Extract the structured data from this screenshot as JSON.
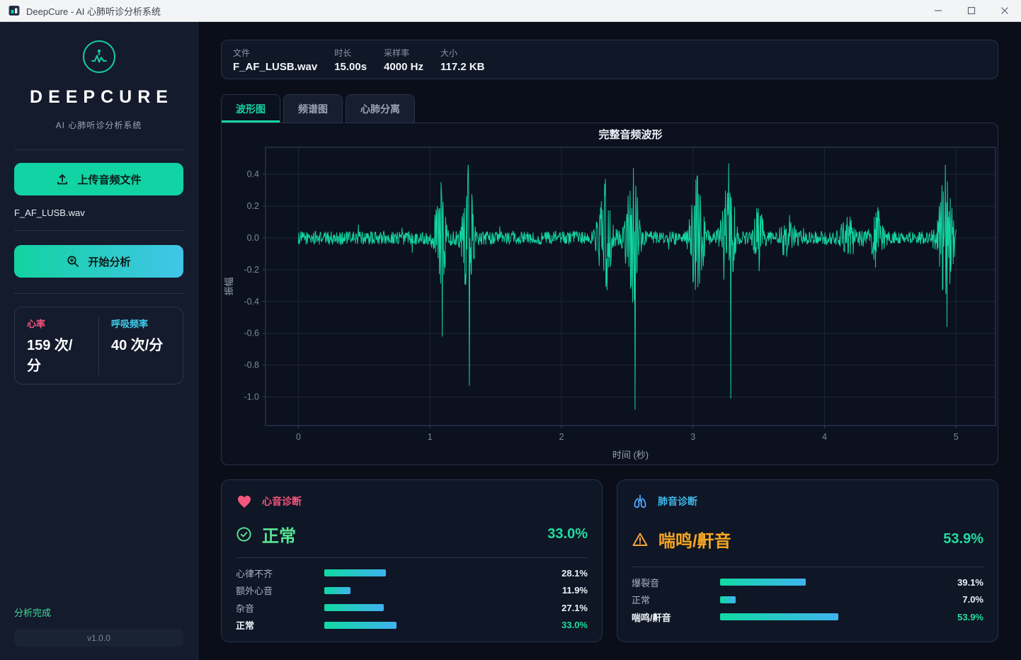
{
  "window": {
    "title": "DeepCure - AI 心肺听诊分析系统"
  },
  "sidebar": {
    "brand": "DEEPCURE",
    "subtitle": "AI 心肺听诊分析系统",
    "upload_button": "上传音频文件",
    "file_name": "F_AF_LUSB.wav",
    "analyze_button": "开始分析",
    "stats": {
      "heart_rate_label": "心率",
      "heart_rate_value": "159 次/分",
      "resp_rate_label": "呼吸频率",
      "resp_rate_value": "40 次/分"
    },
    "status": "分析完成",
    "version": "v1.0.0"
  },
  "file_info": {
    "items": [
      {
        "label": "文件",
        "value": "F_AF_LUSB.wav"
      },
      {
        "label": "时长",
        "value": "15.00s"
      },
      {
        "label": "采样率",
        "value": "4000 Hz"
      },
      {
        "label": "大小",
        "value": "117.2 KB"
      }
    ]
  },
  "tabs": [
    {
      "label": "波形图",
      "active": true
    },
    {
      "label": "频谱图",
      "active": false
    },
    {
      "label": "心肺分离",
      "active": false
    }
  ],
  "chart_data": {
    "type": "line",
    "title": "完整音频波形",
    "xlabel": "时间 (秒)",
    "ylabel": "振幅",
    "xlim": [
      -0.25,
      5.3
    ],
    "ylim": [
      -1.18,
      0.57
    ],
    "x_ticks": [
      0,
      1,
      2,
      3,
      4,
      5
    ],
    "x_tick_labels": [
      "0",
      "1",
      "2",
      "3",
      "4",
      "5"
    ],
    "y_ticks": [
      0.4,
      0.2,
      0.0,
      -0.2,
      -0.4,
      -0.6,
      -0.8,
      -1.0
    ],
    "y_tick_labels": [
      "0.4",
      "0.2",
      "0.0",
      "-0.2",
      "-0.4",
      "-0.6",
      "-0.8",
      "-1.0"
    ],
    "grid": true,
    "line_color": "#13d39e",
    "grid_color": "#1c2637",
    "spine_color": "#34415c",
    "tick_color": "#7e8799",
    "signal": {
      "duration": 5,
      "samples": 1600,
      "seed": 1234,
      "noise_amp": 0.042,
      "bursts": [
        [
          1.08,
          0.3,
          0.03
        ],
        [
          1.29,
          0.4,
          0.028
        ],
        [
          2.33,
          0.34,
          0.035
        ],
        [
          2.54,
          0.42,
          0.035
        ],
        [
          3.03,
          0.36,
          0.035
        ],
        [
          3.27,
          0.43,
          0.032
        ],
        [
          3.5,
          0.18,
          0.025
        ],
        [
          3.72,
          0.12,
          0.035
        ],
        [
          4.18,
          0.1,
          0.045
        ],
        [
          4.4,
          0.17,
          0.03
        ],
        [
          4.92,
          0.4,
          0.04
        ]
      ],
      "deep_spikes": [
        [
          1.095,
          -0.62
        ],
        [
          1.3,
          -0.93
        ],
        [
          2.558,
          -1.08
        ],
        [
          3.288,
          -1.01
        ],
        [
          4.93,
          -0.56
        ]
      ],
      "peaks": [
        [
          1.085,
          0.35
        ],
        [
          1.292,
          0.46
        ],
        [
          2.335,
          0.37
        ],
        [
          2.548,
          0.44
        ],
        [
          3.035,
          0.39
        ],
        [
          3.272,
          0.47
        ],
        [
          4.918,
          0.46
        ]
      ]
    }
  },
  "diagnosis": {
    "bar_gradient": [
      "#10d9a2",
      "#3fb3ef"
    ],
    "heart": {
      "header": "心音诊断",
      "result": "正常",
      "confidence": "33.0%",
      "rows": [
        {
          "label": "心律不齐",
          "pct": 28.1,
          "display": "28.1%",
          "emphasis": false
        },
        {
          "label": "额外心音",
          "pct": 11.9,
          "display": "11.9%",
          "emphasis": false
        },
        {
          "label": "杂音",
          "pct": 27.1,
          "display": "27.1%",
          "emphasis": false
        },
        {
          "label": "正常",
          "pct": 33.0,
          "display": "33.0%",
          "emphasis": true
        }
      ]
    },
    "lung": {
      "header": "肺音诊断",
      "result": "喘鸣/鼾音",
      "confidence": "53.9%",
      "rows": [
        {
          "label": "爆裂音",
          "pct": 39.1,
          "display": "39.1%",
          "emphasis": false
        },
        {
          "label": "正常",
          "pct": 7.0,
          "display": "7.0%",
          "emphasis": false
        },
        {
          "label": "喘鸣/鼾音",
          "pct": 53.9,
          "display": "53.9%",
          "emphasis": true
        }
      ]
    }
  }
}
